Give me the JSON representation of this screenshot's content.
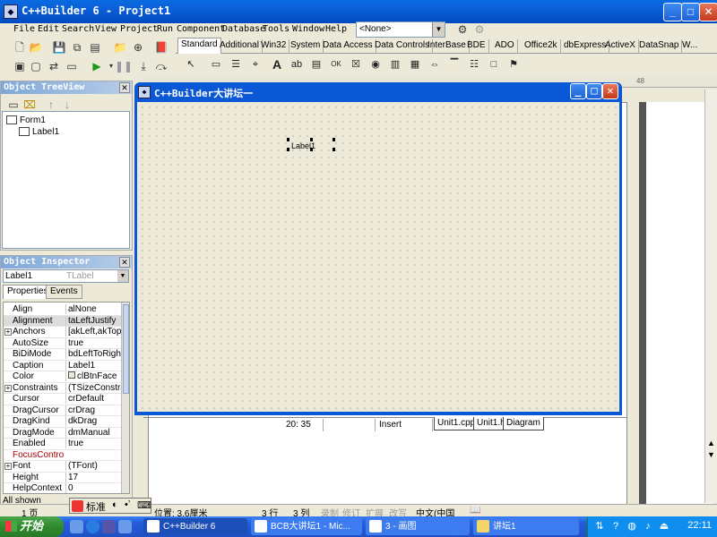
{
  "main_window": {
    "title": "C++Builder 6 - Project1",
    "menu": [
      "File",
      "Edit",
      "Search",
      "View",
      "Project",
      "Run",
      "Component",
      "Database",
      "Tools",
      "Window",
      "Help"
    ],
    "config_combo": "<None>"
  },
  "palette": {
    "tabs": [
      "Standard",
      "Additional",
      "Win32",
      "System",
      "Data Access",
      "Data Controls",
      "InterBase",
      "BDE",
      "ADO",
      "Office2k",
      "dbExpress",
      "ActiveX",
      "DataSnap",
      "W..."
    ],
    "active_tab": "Standard"
  },
  "object_treeview": {
    "title": "Object TreeView",
    "items": [
      "Form1",
      "Label1"
    ]
  },
  "object_inspector": {
    "title": "Object Inspector",
    "selected_object": "Label1",
    "selected_type": "TLabel",
    "tabs": [
      "Properties",
      "Events"
    ],
    "properties": [
      {
        "name": "Align",
        "value": "alNone"
      },
      {
        "name": "Alignment",
        "value": "taLeftJustify"
      },
      {
        "name": "Anchors",
        "value": "[akLeft,akTop]",
        "expand": true
      },
      {
        "name": "AutoSize",
        "value": "true"
      },
      {
        "name": "BiDiMode",
        "value": "bdLeftToRight"
      },
      {
        "name": "Caption",
        "value": "Label1"
      },
      {
        "name": "Color",
        "value": "clBtnFace"
      },
      {
        "name": "Constraints",
        "value": "(TSizeConstrain",
        "expand": true
      },
      {
        "name": "Cursor",
        "value": "crDefault"
      },
      {
        "name": "DragCursor",
        "value": "crDrag"
      },
      {
        "name": "DragKind",
        "value": "dkDrag"
      },
      {
        "name": "DragMode",
        "value": "dmManual"
      },
      {
        "name": "Enabled",
        "value": "true"
      },
      {
        "name": "FocusControl",
        "value": ""
      },
      {
        "name": "Font",
        "value": "(TFont)",
        "expand": true
      },
      {
        "name": "Height",
        "value": "17"
      },
      {
        "name": "HelpContext",
        "value": "0"
      }
    ],
    "footer": "All shown"
  },
  "form": {
    "title": "C++Builder大讲坛一",
    "label_caption": "Label1"
  },
  "form_status": {
    "position": "20: 35",
    "mode": "Insert",
    "tabs": [
      "Unit1.cpp",
      "Unit1.h",
      "Diagram"
    ]
  },
  "editor_ruler": {
    "mark": "48"
  },
  "word_status": {
    "ime_label": "标准",
    "page": "1 页",
    "position": "位置: 3.6厘米",
    "line": "3 行",
    "col": "3 列",
    "rec": "录制",
    "rev": "修订",
    "ext": "扩展",
    "ovr": "改写",
    "lang": "中文(中国"
  },
  "taskbar": {
    "start_label": "开始",
    "tasks": [
      "C++Builder 6",
      "BCB大讲坛1 - Mic...",
      "3 - 画图",
      "讲坛1"
    ],
    "clock": "22:11"
  }
}
